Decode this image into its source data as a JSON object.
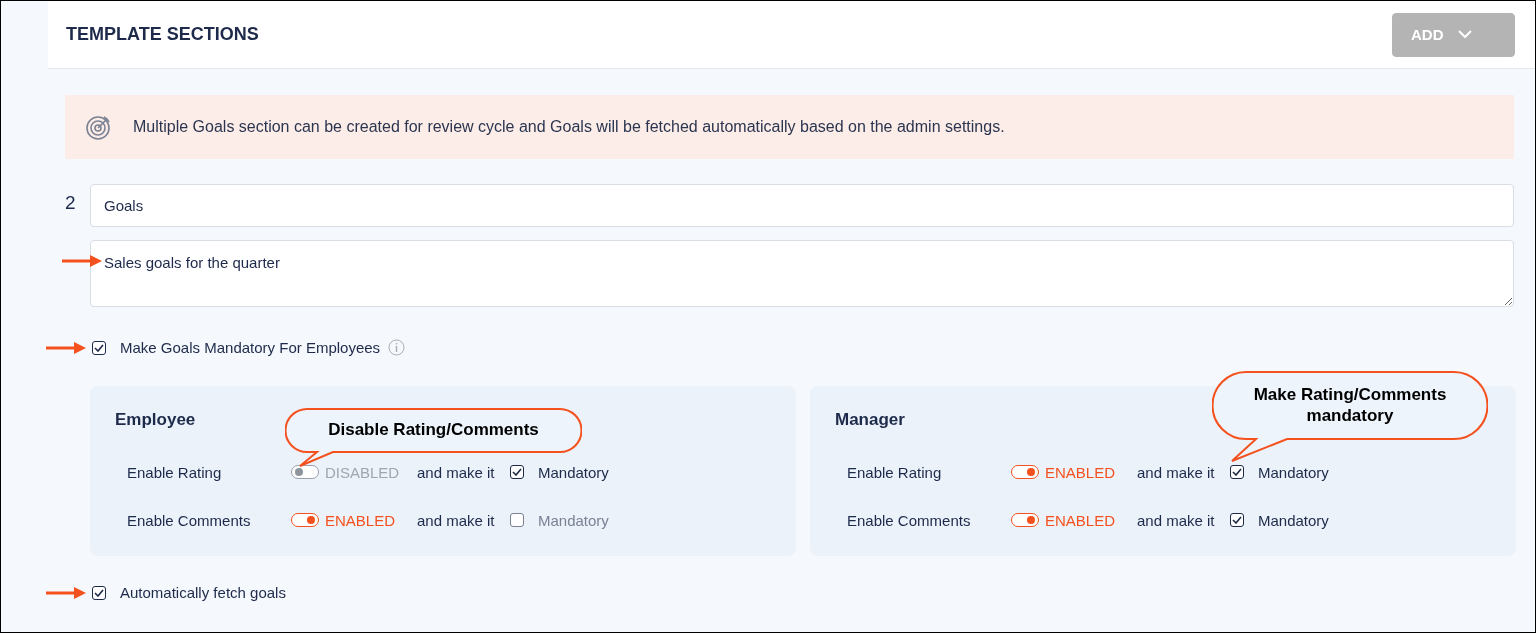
{
  "header": {
    "title": "TEMPLATE SECTIONS",
    "add_button": {
      "label": "ADD",
      "disabled": true
    }
  },
  "notice": {
    "text": "Multiple Goals section can be created for review cycle and Goals will be fetched automatically based on the admin settings."
  },
  "section": {
    "number": "2",
    "title_value": "Goals",
    "description_value": "Sales goals for the quarter",
    "description_arrow": true
  },
  "mandatory_option": {
    "label": "Make Goals Mandatory For Employees",
    "checked": true,
    "arrow": true
  },
  "panels": [
    {
      "title": "Employee",
      "callout": {
        "kind": "toggle",
        "text": "Disable Rating/Comments"
      },
      "rows": [
        {
          "label": "Enable Rating",
          "enabled": false,
          "status": "DISABLED",
          "connector": "and make it",
          "mandatory": true,
          "mandatory_label": "Mandatory"
        },
        {
          "label": "Enable Comments",
          "enabled": true,
          "status": "ENABLED",
          "connector": "and make it",
          "mandatory": false,
          "mandatory_label": "Mandatory"
        }
      ]
    },
    {
      "title": "Manager",
      "callout": {
        "kind": "checkbox",
        "text": "Make Rating/Comments mandatory"
      },
      "rows": [
        {
          "label": "Enable Rating",
          "enabled": true,
          "status": "ENABLED",
          "connector": "and make it",
          "mandatory": true,
          "mandatory_label": "Mandatory"
        },
        {
          "label": "Enable Comments",
          "enabled": true,
          "status": "ENABLED",
          "connector": "and make it",
          "mandatory": true,
          "mandatory_label": "Mandatory"
        }
      ]
    }
  ],
  "fetch_option": {
    "label": "Automatically fetch goals",
    "checked": true,
    "arrow": true
  }
}
